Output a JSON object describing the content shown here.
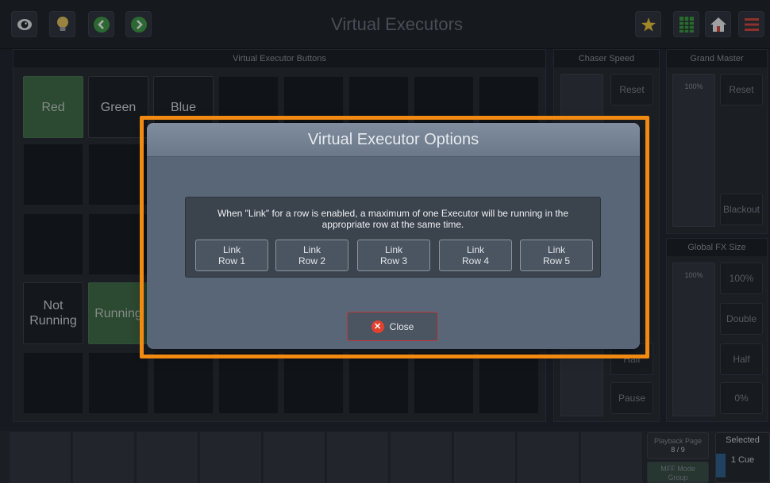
{
  "topbar": {
    "title": "Virtual Executors"
  },
  "icons": {
    "eye": "eye-icon",
    "bulb": "lightbulb-icon",
    "back": "chevron-left-icon",
    "forward": "chevron-right-icon",
    "magic": "magic-star-icon",
    "sheet": "spreadsheet-icon",
    "home": "home-icon",
    "menu": "menu-lines-icon"
  },
  "executor_panel": {
    "title": "Virtual Executor Buttons",
    "row1": [
      "Red",
      "Green",
      "Blue"
    ],
    "row4_not_running": "Not Running",
    "row4_running": "Running"
  },
  "chaser_speed": {
    "title": "Chaser Speed",
    "reset_label": "Reset",
    "pause_label": "Pause",
    "partial_half": "Half"
  },
  "grand_master": {
    "title": "Grand Master",
    "fader_value": "100%",
    "reset_label": "Reset",
    "blackout_label": "Blackout"
  },
  "global_fx": {
    "title": "Global FX Size",
    "fader_value": "100%",
    "btn_100": "100%",
    "btn_double": "Double",
    "btn_half": "Half",
    "btn_zero": "0%"
  },
  "bottombar": {
    "playback_page_label": "Playback Page",
    "playback_page_value": "8 / 9",
    "mff_mode_label": "MFF Mode",
    "mff_mode_value": "Group",
    "selected_label": "Selected",
    "selected_value": "1 Cue"
  },
  "modal": {
    "title": "Virtual Executor Options",
    "description": "When \"Link\" for a row is enabled, a maximum of one Executor will be running in the appropriate row at the same time.",
    "link_buttons": [
      {
        "line1": "Link",
        "line2": "Row 1"
      },
      {
        "line1": "Link",
        "line2": "Row 2"
      },
      {
        "line1": "Link",
        "line2": "Row 3"
      },
      {
        "line1": "Link",
        "line2": "Row 4"
      },
      {
        "line1": "Link",
        "line2": "Row 5"
      }
    ],
    "close_label": "Close"
  },
  "colors": {
    "accent_highlight": "#f28a12",
    "running_green": "#3f6a44",
    "close_red": "#e2412f"
  }
}
